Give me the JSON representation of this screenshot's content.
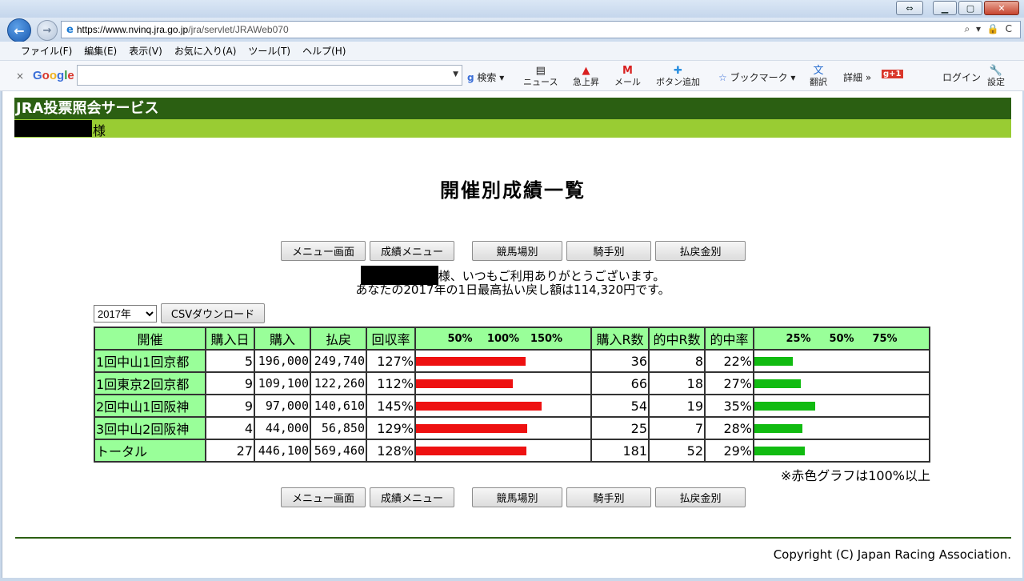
{
  "browser": {
    "url_scheme": "https://www.",
    "url_domain": "nvinq.jra.go.jp",
    "url_path": "/jra/servlet/JRAWeb070",
    "url_tools": "⌕ ▾ 🔒 C",
    "menus": [
      "ファイル(F)",
      "編集(E)",
      "表示(V)",
      "お気に入り(A)",
      "ツール(T)",
      "ヘルプ(H)"
    ],
    "toolbar": {
      "close": "×",
      "google": "Google",
      "search": "検索",
      "news": "ニュース",
      "trend": "急上昇",
      "mail": "メール",
      "add_button": "ボタン追加",
      "bookmark": "ブックマーク",
      "translate": "翻訳",
      "details": "詳細 »",
      "gplus": "g+1",
      "login": "ログイン",
      "settings": "設定"
    }
  },
  "site": {
    "header_title": "JRA投票照会サービス",
    "user_suffix": "様"
  },
  "page": {
    "title": "開催別成績一覧",
    "buttons": [
      "メニュー画面",
      "成績メニュー",
      "競馬場別",
      "騎手別",
      "払戻金別"
    ],
    "greeting_line1": "様、いつもご利用ありがとうございます。",
    "greeting_line2": "あなたの2017年の1日最高払い戻し額は114,320円です。",
    "year_options": [
      "2017年"
    ],
    "csv_button": "CSVダウンロード",
    "note": "※赤色グラフは100%以上",
    "copyright": "Copyright (C) Japan Racing Association."
  },
  "table": {
    "headers": [
      "開催",
      "購入日",
      "購入",
      "払戻",
      "回収率",
      "購入R数",
      "的中R数",
      "的中率"
    ],
    "recovery_scale": [
      "50%",
      "100%",
      "150%"
    ],
    "hit_scale": [
      "25%",
      "50%",
      "75%"
    ],
    "rows": [
      {
        "name": "1回中山1回京都",
        "days": "5",
        "bet": "196,000",
        "payout": "249,740",
        "recovery": "127%",
        "recovery_value": 127,
        "races": "36",
        "hits": "8",
        "hit_rate": "22%",
        "hit_value": 22
      },
      {
        "name": "1回東京2回京都",
        "days": "9",
        "bet": "109,100",
        "payout": "122,260",
        "recovery": "112%",
        "recovery_value": 112,
        "races": "66",
        "hits": "18",
        "hit_rate": "27%",
        "hit_value": 27
      },
      {
        "name": "2回中山1回阪神",
        "days": "9",
        "bet": "97,000",
        "payout": "140,610",
        "recovery": "145%",
        "recovery_value": 145,
        "races": "54",
        "hits": "19",
        "hit_rate": "35%",
        "hit_value": 35
      },
      {
        "name": "3回中山2回阪神",
        "days": "4",
        "bet": "44,000",
        "payout": "56,850",
        "recovery": "129%",
        "recovery_value": 129,
        "races": "25",
        "hits": "7",
        "hit_rate": "28%",
        "hit_value": 28
      },
      {
        "name": "トータル",
        "days": "27",
        "bet": "446,100",
        "payout": "569,460",
        "recovery": "128%",
        "recovery_value": 128,
        "races": "181",
        "hits": "52",
        "hit_rate": "29%",
        "hit_value": 29
      }
    ]
  },
  "colors": {
    "header_green": "#2b5f12",
    "sub_green": "#99cc33",
    "table_header": "#99ff99",
    "bar_red": "#ee1111",
    "bar_green": "#11bb11"
  }
}
